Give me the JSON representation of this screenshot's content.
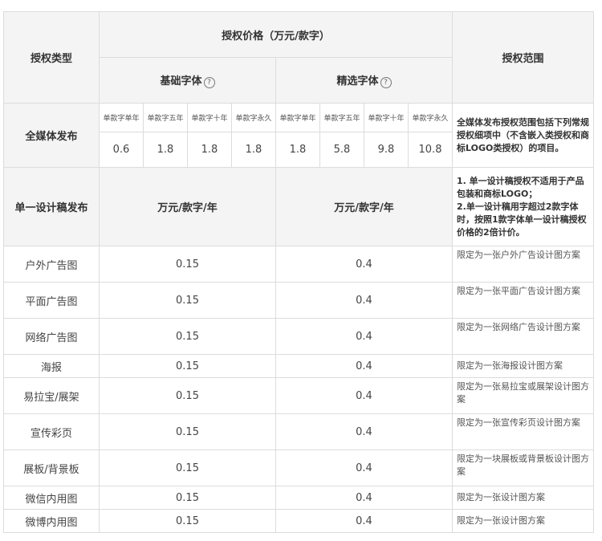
{
  "header": {
    "auth_type": "授权类型",
    "price_title": "授权价格（万元/款字）",
    "scope": "授权范围",
    "basic_font": "基础字体",
    "premium_font": "精选字体",
    "help_glyph": "?"
  },
  "term_labels": [
    "单款字单年",
    "单款字五年",
    "单款字十年",
    "单款字永久"
  ],
  "all_media": {
    "label": "全媒体发布",
    "basic_prices": [
      "0.6",
      "1.8",
      "1.8",
      "1.8"
    ],
    "premium_prices": [
      "1.8",
      "5.8",
      "9.8",
      "10.8"
    ],
    "scope": "全媒体发布授权范围包括下列常规授权细项中（不含嵌入类授权和商标LOGO类授权）的项目。"
  },
  "single_design": {
    "label": "单一设计稿发布",
    "basic_unit": "万元/款字/年",
    "premium_unit": "万元/款字/年",
    "scope_line1": "1. 单一设计稿授权不适用于产品包装和商标LOGO；",
    "scope_line2": "2.单一设计稿用字超过2款字体时，按照1款字体单一设计稿授权价格的2倍计价。"
  },
  "rows": [
    {
      "name": "户外广告图",
      "basic": "0.15",
      "premium": "0.4",
      "scope": "限定为一张户外广告设计图方案"
    },
    {
      "name": "平面广告图",
      "basic": "0.15",
      "premium": "0.4",
      "scope": "限定为一张平面广告设计图方案"
    },
    {
      "name": "网络广告图",
      "basic": "0.15",
      "premium": "0.4",
      "scope": "限定为一张网络广告设计图方案"
    },
    {
      "name": "海报",
      "basic": "0.15",
      "premium": "0.4",
      "scope": "限定为一张海报设计图方案"
    },
    {
      "name": "易拉宝/展架",
      "basic": "0.15",
      "premium": "0.4",
      "scope": "限定为一张易拉宝或展架设计图方案"
    },
    {
      "name": "宣传彩页",
      "basic": "0.15",
      "premium": "0.4",
      "scope": "限定为一张宣传彩页设计图方案"
    },
    {
      "name": "展板/背景板",
      "basic": "0.15",
      "premium": "0.4",
      "scope": "限定为一块展板或背景板设计图方案"
    },
    {
      "name": "微信内用图",
      "basic": "0.15",
      "premium": "0.4",
      "scope": "限定为一张设计图方案"
    },
    {
      "name": "微博内用图",
      "basic": "0.15",
      "premium": "0.4",
      "scope": "限定为一张设计图方案"
    }
  ]
}
